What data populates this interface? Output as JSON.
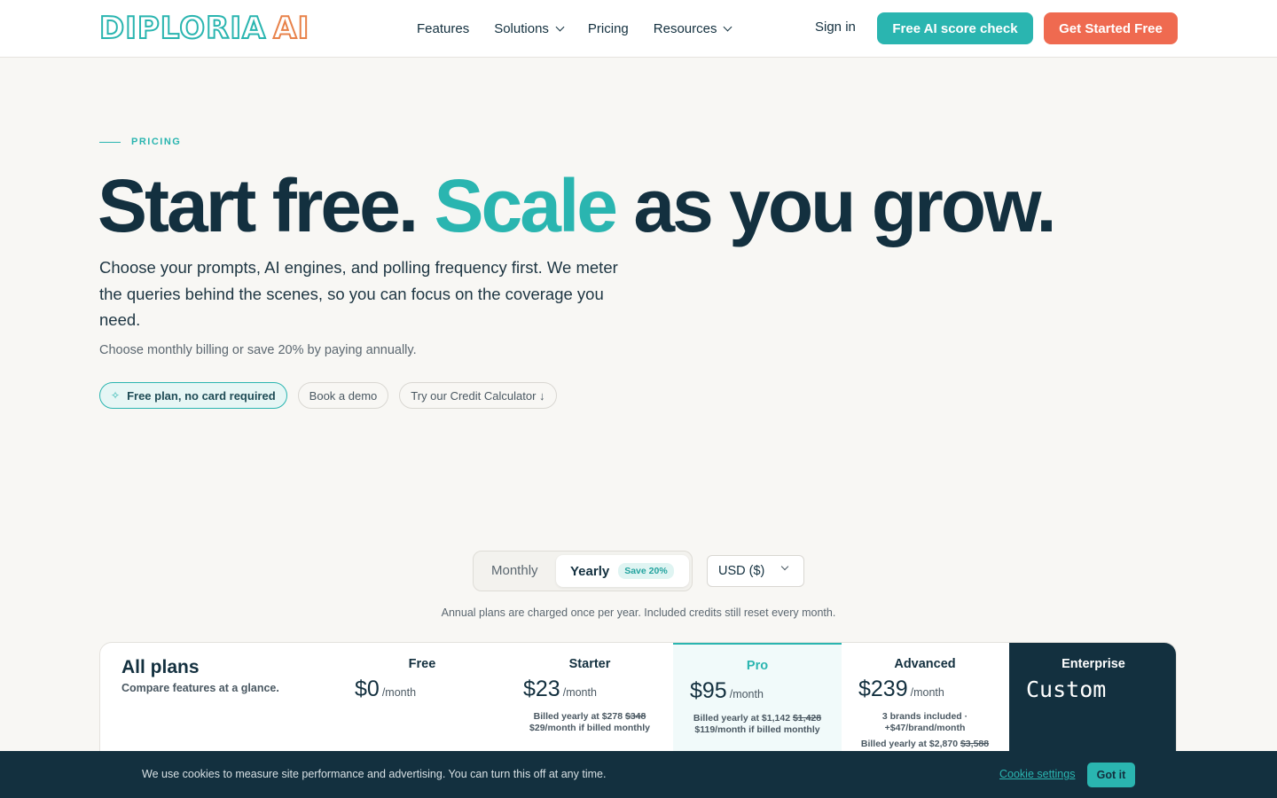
{
  "header": {
    "logo_main": "DIPLORIA",
    "logo_ai": "AI",
    "nav": [
      {
        "label": "Features"
      },
      {
        "label": "Solutions"
      },
      {
        "label": "Pricing"
      },
      {
        "label": "Resources"
      }
    ],
    "sign_in": "Sign in",
    "score_check": "Free AI score check",
    "get_started": "Get Started Free"
  },
  "hero": {
    "eyebrow": "PRICING",
    "headline_part1": "Start free.",
    "headline_accent": "Scale",
    "headline_part2": "as you grow.",
    "lead": "Choose your prompts, AI engines, and polling frequency first. We meter the queries behind the scenes, so you can focus on the coverage you need.",
    "sublead": "Choose monthly billing or save 20% by paying annually.",
    "chips": [
      {
        "label": "Free plan, no card required",
        "icon": "spark-icon"
      },
      {
        "label": "Book a demo"
      },
      {
        "label": "Try our Credit Calculator ↓"
      }
    ]
  },
  "billing": {
    "monthly": "Monthly",
    "yearly": "Yearly",
    "save_badge": "Save 20%",
    "selected": "Yearly",
    "currency": "USD ($)",
    "note": "Annual plans are charged once per year. Included credits still reset every month."
  },
  "plans_table": {
    "title": "All plans",
    "subtitle": "Compare features at a glance.",
    "plans": [
      {
        "name": "Free",
        "price": "$0",
        "per": "/month"
      },
      {
        "name": "Starter",
        "price": "$23",
        "per": "/month",
        "billed_prefix": "Billed yearly at $278",
        "billed_strike": "$348",
        "monthly_note": "$29/month if billed monthly"
      },
      {
        "name": "Pro",
        "price": "$95",
        "per": "/month",
        "billed_prefix": "Billed yearly at $1,142",
        "billed_strike": "$1,428",
        "monthly_note": "$119/month if billed monthly"
      },
      {
        "name": "Advanced",
        "price": "$239",
        "per": "/month",
        "brands_note": "3 brands included ·",
        "brands_extra": "+$47/brand/month",
        "billed_prefix": "Billed yearly at $2,870",
        "billed_strike": "$3,588"
      },
      {
        "name": "Enterprise",
        "price": "Custom"
      }
    ]
  },
  "cookie": {
    "text": "We use cookies to measure site performance and advertising. You can turn this off at any time.",
    "settings": "Cookie settings",
    "accept": "Got it"
  },
  "colors": {
    "teal": "#2ab5b0",
    "coral": "#ef6a50",
    "navy": "#13303f",
    "background": "#f8f7f4"
  }
}
